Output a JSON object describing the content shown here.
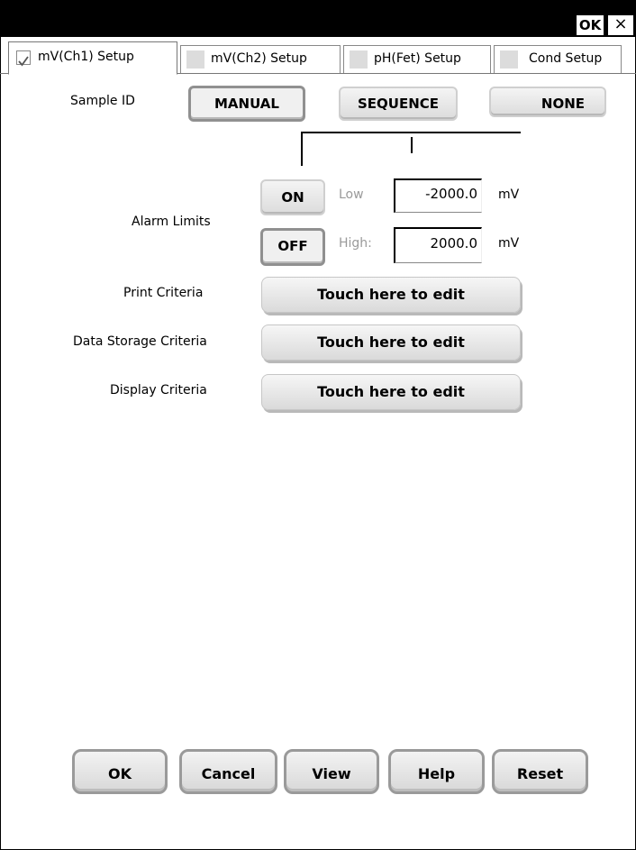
{
  "titlebar": {
    "ok_label": "OK",
    "close_label": "×"
  },
  "tabs": [
    {
      "label": "mV(Ch1) Setup",
      "active": true
    },
    {
      "label": "mV(Ch2) Setup",
      "active": false
    },
    {
      "label": "pH(Fet) Setup",
      "active": false
    },
    {
      "label": "Cond Setup",
      "active": false
    }
  ],
  "sample_id": {
    "label": "Sample ID",
    "options": [
      "MANUAL",
      "SEQUENCE",
      "NONE"
    ],
    "selected": "MANUAL"
  },
  "alarm": {
    "label": "Alarm Limits",
    "on_label": "ON",
    "off_label": "OFF",
    "selected": "OFF",
    "low_label": "Low",
    "low_value": "-2000.0",
    "high_label": "High:",
    "high_value": "2000.0",
    "unit": "mV"
  },
  "criteria": [
    {
      "label": "Print Criteria",
      "button": "Touch here to edit"
    },
    {
      "label": "Data Storage Criteria",
      "button": "Touch here to edit"
    },
    {
      "label": "Display Criteria",
      "button": "Touch here to edit"
    }
  ],
  "footer": {
    "ok": "OK",
    "cancel": "Cancel",
    "view": "View",
    "help": "Help",
    "reset": "Reset"
  }
}
